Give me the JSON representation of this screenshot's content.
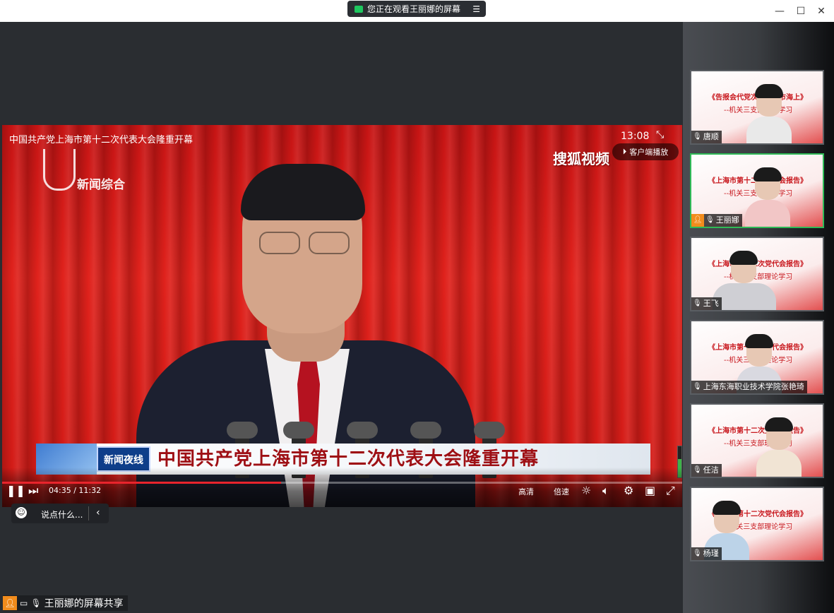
{
  "window": {
    "share_banner": "您正在观看王丽娜的屏幕",
    "minimize": "—",
    "maximize": "☐",
    "close": "✕"
  },
  "video": {
    "title": "中国共产党上海市第十二次代表大会隆重开幕",
    "clock": "13:08",
    "client_play": "客户端播放",
    "sohu_logo": "搜狐视频",
    "channel_logo": "新闻综合",
    "lower_badge": "新闻夜线",
    "lower_third": "中国共产党上海市第十二次代表大会隆重开幕",
    "progress_fraction": 0.41,
    "volume_fraction": 0.6
  },
  "controls": {
    "time": "04:35 / 11:32",
    "quality": "高清",
    "speed": "倍速"
  },
  "comment": {
    "placeholder": "说点什么..."
  },
  "share_label": "王丽娜的屏幕共享",
  "participants": [
    {
      "name": "唐顺",
      "slide_line1": "《告报会代党次二十第市海上》",
      "slide_line2": "--机关三支部理论学习"
    },
    {
      "name": "王丽娜",
      "slide_line1": "《上海市第十二次党代会报告》",
      "slide_line2": "--机关三支部理论学习"
    },
    {
      "name": "王飞",
      "slide_line1": "《上海市第十二次党代会报告》",
      "slide_line2": "--机关三支部理论学习"
    },
    {
      "name": "上海东海职业技术学院张艳琦",
      "slide_line1": "《上海市第十二次党代会报告》",
      "slide_line2": "--机关三支部理论学习"
    },
    {
      "name": "任洁",
      "slide_line1": "《上海市第十二次党代会报告》",
      "slide_line2": "--机关三支部理论学习"
    },
    {
      "name": "杨瑾",
      "slide_line1": "《上海市第十二次党代会报告》",
      "slide_line2": "--机关三支部理论学习"
    }
  ]
}
